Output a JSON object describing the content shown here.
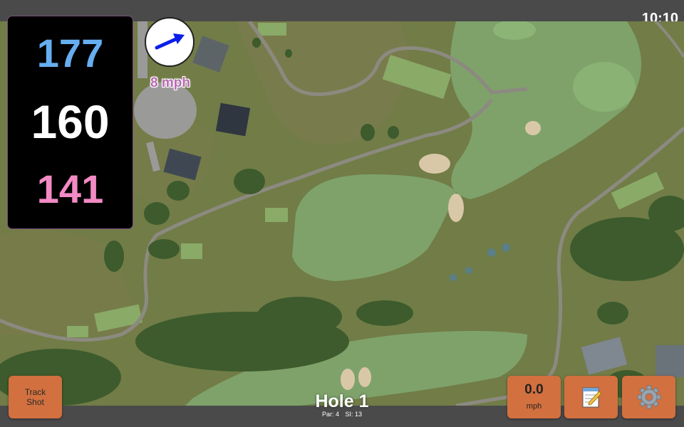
{
  "status": {
    "time": "10:10"
  },
  "distances": {
    "back": "177",
    "center": "160",
    "front": "141",
    "colors": {
      "back": "#66aef0",
      "center": "#ffffff",
      "front": "#f28ac4"
    }
  },
  "wind": {
    "speed": "8 mph",
    "arrow_icon": "wind-direction-arrow",
    "arrow_color": "#0b1ee8",
    "text_color": "#b86ab3"
  },
  "hole": {
    "title": "Hole 1",
    "par": "Par: 4",
    "si": "SI: 13"
  },
  "buttons": {
    "track_shot": "Track Shot",
    "speed_value": "0.0",
    "speed_unit": "mph",
    "notes_icon": "notepad-icon",
    "settings_icon": "gear-icon",
    "color": "#d2703f"
  }
}
